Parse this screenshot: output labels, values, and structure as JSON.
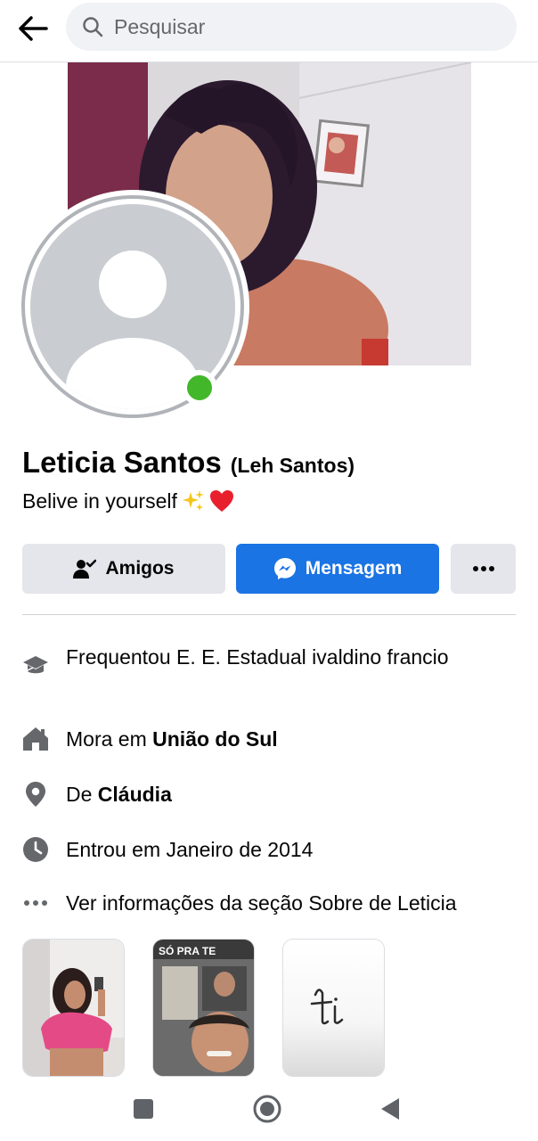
{
  "header": {
    "back_icon": "arrow-left-icon",
    "search_icon": "search-icon",
    "search_placeholder": "Pesquisar"
  },
  "profile": {
    "name": "Leticia Santos",
    "nickname": "(Leh Santos)",
    "bio": "Belive in yourself",
    "bio_emojis": [
      "sparkles",
      "red-heart"
    ],
    "online": true,
    "online_color": "#42b72a"
  },
  "actions": {
    "friends_label": "Amigos",
    "friends_icon": "person-check-icon",
    "message_label": "Mensagem",
    "message_icon": "messenger-icon",
    "message_color": "#1b74e4",
    "more_icon": "more-horizontal-icon"
  },
  "info": {
    "education": {
      "icon": "graduation-cap-icon",
      "text": "Frequentou E. E. Estadual ivaldino francio"
    },
    "lives": {
      "icon": "home-icon",
      "prefix": "Mora em",
      "value": "União do Sul"
    },
    "from": {
      "icon": "location-pin-icon",
      "prefix": "De",
      "value": "Cláudia"
    },
    "joined": {
      "icon": "clock-icon",
      "text": "Entrou em Janeiro de 2014"
    },
    "about_link": {
      "icon": "more-horizontal-icon",
      "text": "Ver informações da seção Sobre de Leticia"
    }
  },
  "photos": [
    {
      "name": "photo-selfie"
    },
    {
      "name": "photo-video-call",
      "tag": "SÓ PRA TE"
    },
    {
      "name": "photo-handwriting"
    }
  ],
  "navbar": {
    "recent_icon": "square-icon",
    "home_icon": "circle-home-icon",
    "back_icon": "triangle-back-icon"
  }
}
